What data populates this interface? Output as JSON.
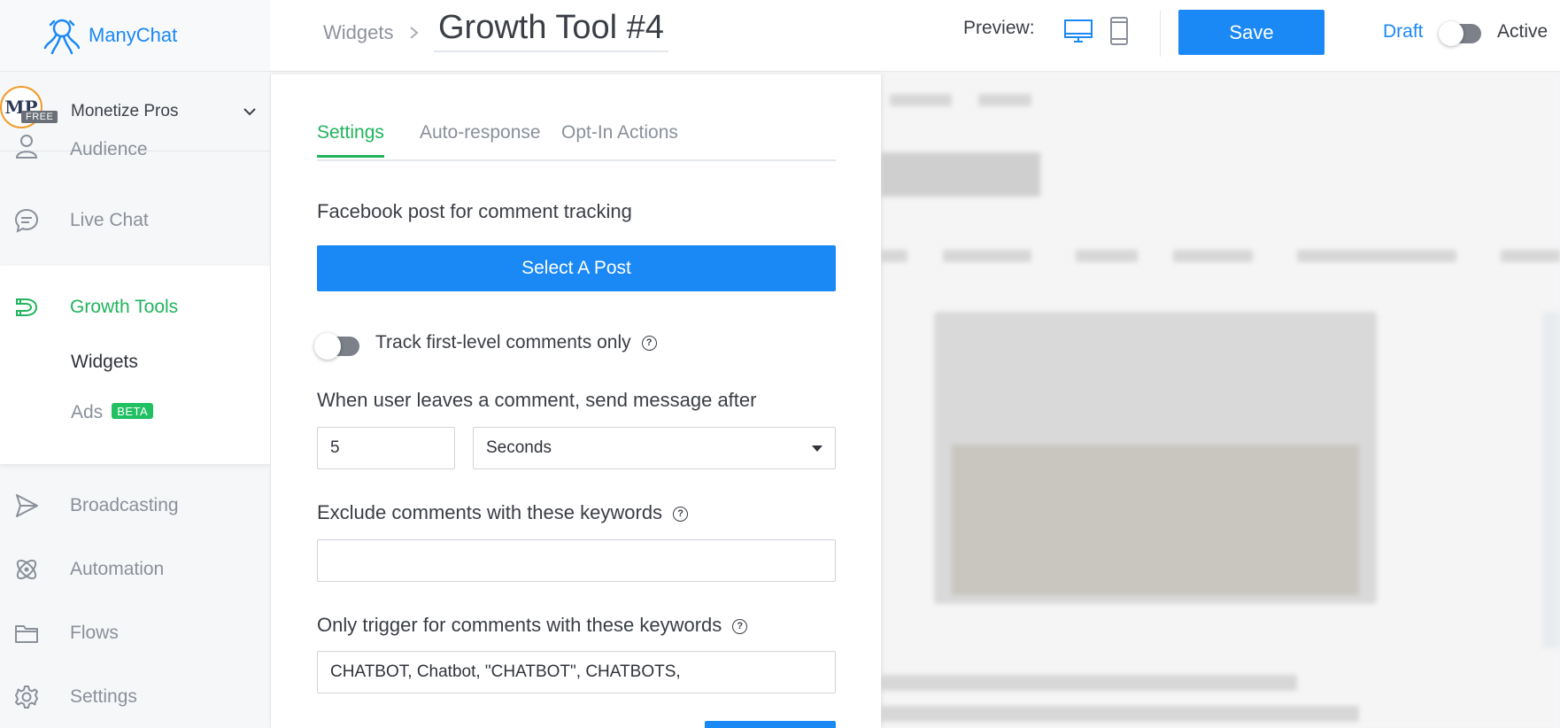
{
  "brand": {
    "name": "ManyChat"
  },
  "account": {
    "name": "Monetize Pros",
    "initials": "MP",
    "plan_badge": "FREE"
  },
  "sidebar": {
    "items": [
      {
        "label": "Audience",
        "icon": "person-icon"
      },
      {
        "label": "Live Chat",
        "icon": "chat-bubble-icon"
      },
      {
        "label": "Growth Tools",
        "icon": "magnet-icon",
        "active": true
      },
      {
        "label": "Broadcasting",
        "icon": "send-icon"
      },
      {
        "label": "Automation",
        "icon": "atom-icon"
      },
      {
        "label": "Flows",
        "icon": "folder-icon"
      },
      {
        "label": "Settings",
        "icon": "gear-icon"
      }
    ],
    "growth_sub": [
      {
        "label": "Widgets"
      },
      {
        "label": "Ads",
        "badge": "BETA"
      }
    ]
  },
  "topbar": {
    "breadcrumb": "Widgets",
    "separator": ">",
    "title": "Growth Tool #4",
    "preview_label": "Preview:",
    "save_label": "Save",
    "draft_label": "Draft",
    "active_label": "Active"
  },
  "editor": {
    "tabs": [
      {
        "label": "Settings",
        "active": true
      },
      {
        "label": "Auto-response"
      },
      {
        "label": "Opt-In Actions"
      }
    ],
    "post_label": "Facebook post for comment tracking",
    "select_post_label": "Select A Post",
    "track_first_level_label": "Track first-level comments only",
    "track_first_level_enabled": false,
    "delay_label": "When user leaves a comment, send message after",
    "delay_value": "5",
    "delay_unit": "Seconds",
    "exclude_label": "Exclude comments with these keywords",
    "exclude_value": "",
    "trigger_label": "Only trigger for comments with these keywords",
    "trigger_value": "CHATBOT, Chatbot, \"CHATBOT\", CHATBOTS,"
  },
  "colors": {
    "brand_blue": "#1a88f5",
    "active_green": "#20b45c",
    "beta_green": "#20c063"
  }
}
